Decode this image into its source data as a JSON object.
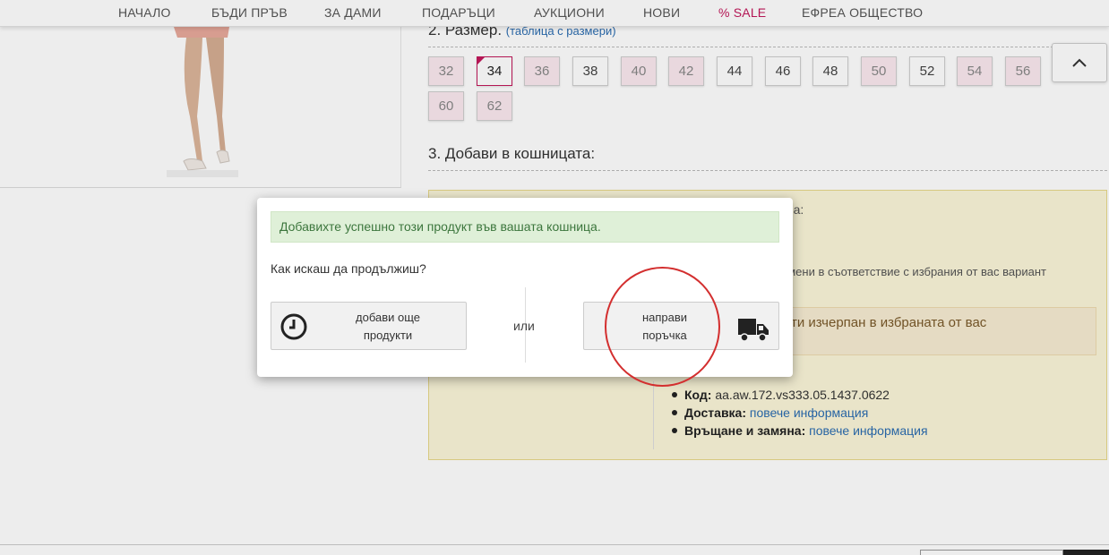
{
  "nav": {
    "items": [
      "НАЧАЛО",
      "БЪДИ ПРЪВ",
      "ЗА ДАМИ",
      "ПОДАРЪЦИ",
      "АУКЦИОНИ",
      "НОВИ",
      "% SALE",
      "ЕФРЕА ОБЩЕСТВО"
    ]
  },
  "size_section": {
    "title": "2. Размер.",
    "size_chart_link": "(таблица с размери)",
    "sizes": [
      {
        "label": "32",
        "available": false
      },
      {
        "label": "34",
        "available": true,
        "selected": true
      },
      {
        "label": "36",
        "available": false
      },
      {
        "label": "38",
        "available": true
      },
      {
        "label": "40",
        "available": false
      },
      {
        "label": "42",
        "available": false
      },
      {
        "label": "44",
        "available": true
      },
      {
        "label": "46",
        "available": true
      },
      {
        "label": "48",
        "available": true
      },
      {
        "label": "50",
        "available": false
      },
      {
        "label": "52",
        "available": true
      },
      {
        "label": "54",
        "available": false
      },
      {
        "label": "56",
        "available": false
      },
      {
        "label": "60",
        "available": false
      },
      {
        "label": "62",
        "available": false
      }
    ]
  },
  "cart_section": {
    "title": "3. Добави в кошницата:"
  },
  "background": {
    "fragment_1": "ора:",
    "fragment_2": "омени в съответствие с избрания от вас вариант",
    "stock_note": "ти изчерпан в избраната от вас"
  },
  "info": {
    "code_label": "Код:",
    "code_value": "aa.aw.172.vs333.05.1437.0622",
    "delivery_label": "Доставка:",
    "delivery_link": "повече информация",
    "returns_label": "Връщане и замяна:",
    "returns_link": "повече информация"
  },
  "modal": {
    "success_message": "Добавихте успешно този продукт във вашата кошница.",
    "question": "Как искаш да продължиш?",
    "continue_line1": "добави още",
    "continue_line2": "продукти",
    "or_text": "или",
    "order_line1": "направи",
    "order_line2": "поръчка"
  },
  "icons": {
    "continue": "clock-icon",
    "order": "truck-icon",
    "scroll_top": "chevron-up-icon"
  },
  "colors": {
    "accent": "#c2185b",
    "success_bg": "#dff0d8",
    "success_text": "#3c763d",
    "annotation_circle": "#d32f2f"
  }
}
